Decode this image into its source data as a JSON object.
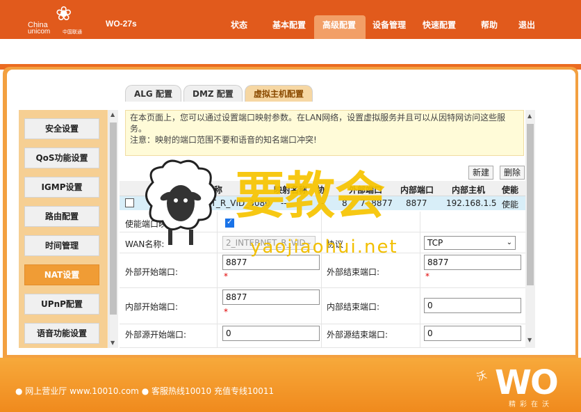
{
  "header": {
    "logo_en_line1": "China",
    "logo_en_line2": "unicom",
    "logo_cn": "中国联通",
    "model": "WO-27s",
    "nav": [
      "状态",
      "基本配置",
      "高级配置",
      "设备管理",
      "快速配置",
      "帮助",
      "退出"
    ],
    "active_nav": "高级配置"
  },
  "tabs": [
    "ALG 配置",
    "DMZ 配置",
    "虚拟主机配置"
  ],
  "active_tab": "虚拟主机配置",
  "sidebar": {
    "items": [
      "安全设置",
      "QoS功能设置",
      "IGMP设置",
      "路由配置",
      "时间管理",
      "NAT设置",
      "UPnP配置",
      "语音功能设置"
    ],
    "active": "NAT设置"
  },
  "info": {
    "line1": "在本页面上，您可以通过设置端口映射参数。在LAN网络，设置虚拟服务并且可以从因特网访问这些服",
    "line2": "务。",
    "line3": "注意：映射的端口范围不要和语音的知名端口冲突!"
  },
  "buttons": {
    "new": "新建",
    "delete": "删除"
  },
  "table": {
    "headers": [
      "WAN名称",
      "映射名称",
      "协议",
      "外部端口",
      "内部端口",
      "内部主机",
      "使能"
    ],
    "header_partial": {
      "mapping": "映射名称",
      "protocol": "协"
    },
    "row": {
      "wan": "2_INTERNET_R_VID_3080",
      "wan_visible_start": "2",
      "wan_visible_end": "ET_R_VID_3080",
      "mapping": "--",
      "protocol": "-",
      "ext_port": "8877--8877",
      "ext_port_visible": "8",
      "ext_port_visible_end": "7--8877",
      "int_port": "8877",
      "host": "192.168.1.5",
      "enable": "使能"
    }
  },
  "form": {
    "enable_label": "使能端口映射",
    "enable_visible": "使能端口映",
    "enable_checked": true,
    "wan_label": "WAN名称:",
    "wan_value": "2_INTERNET_R_VID",
    "protocol_label": "协议",
    "protocol_value": "TCP",
    "ext_start_label": "外部开始端口:",
    "ext_start_value": "8877",
    "ext_end_label": "外部结束端口:",
    "ext_end_value": "8877",
    "int_start_label": "内部开始端口:",
    "int_start_value": "8877",
    "int_end_label": "内部结束端口:",
    "int_end_value": "0",
    "src_start_label": "外部源开始端口:",
    "src_start_value": "0",
    "src_end_label": "外部源结束端口:",
    "src_end_value": "0",
    "required_mark": "*"
  },
  "footer": {
    "text": "● 网上营业厅  www.10010.com ● 客服热线10010  充值专线10011",
    "brand": "WO",
    "brand_cn": "沃",
    "slogan": "精彩在沃"
  },
  "watermark": {
    "text": "要教会",
    "url": "yaojiaohui.net"
  },
  "colors": {
    "header": "#e15a1c",
    "accent": "#f09c35",
    "footer": "#f7a93b"
  }
}
